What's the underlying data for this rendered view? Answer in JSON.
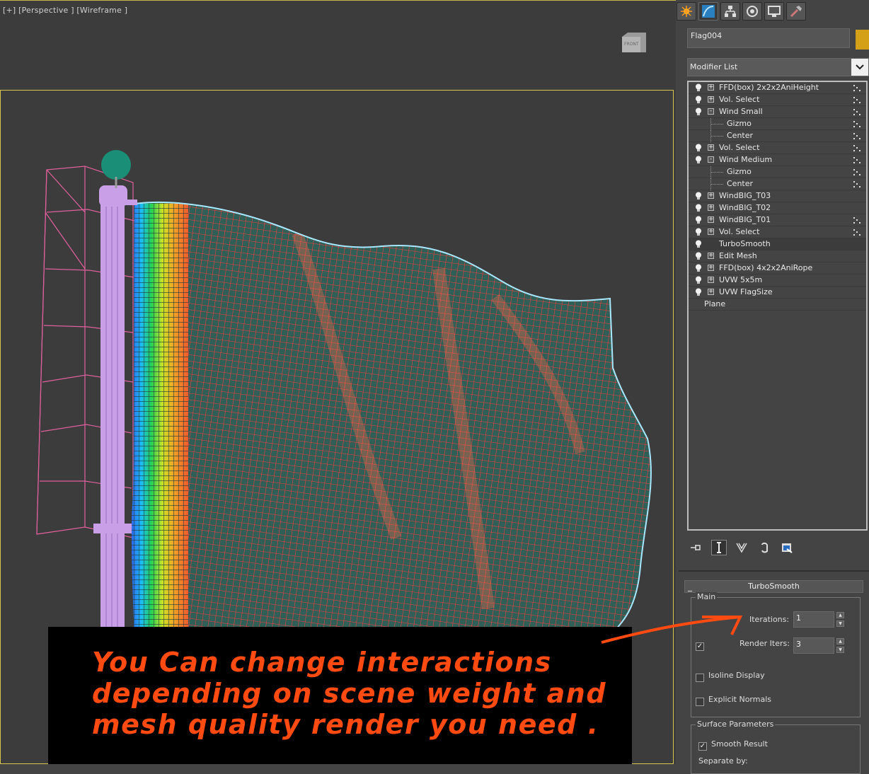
{
  "viewport": {
    "label_plus": "[+]",
    "label_view": "[Perspective ]",
    "label_shading": "[Wireframe ]",
    "viewcube_label": "FRONT"
  },
  "caption": {
    "line1": "You Can  change interactions",
    "line2": "depending on scene weight and",
    "line3": "mesh quality render you need ."
  },
  "panel": {
    "tabs": [
      "create-icon",
      "modify-icon",
      "hierarchy-icon",
      "motion-icon",
      "display-icon",
      "utilities-icon"
    ],
    "object_name": "Flag004",
    "object_color": "#d4a017",
    "modifier_list_label": "Modifier List",
    "stack": [
      {
        "label": "FFD(box) 2x2x2AniHeight",
        "expand": "+",
        "bulb": true,
        "dots": true
      },
      {
        "label": "Vol. Select",
        "expand": "+",
        "bulb": true,
        "dots": true
      },
      {
        "label": "Wind Small",
        "expand": "-",
        "bulb": true,
        "dots": true
      },
      {
        "label": "Gizmo",
        "sub": true,
        "dots": true
      },
      {
        "label": "Center",
        "sub": true,
        "dots": true
      },
      {
        "label": "Vol. Select",
        "expand": "+",
        "bulb": true,
        "dots": true
      },
      {
        "label": "Wind Medium",
        "expand": "-",
        "bulb": true,
        "dots": true
      },
      {
        "label": "Gizmo",
        "sub": true,
        "dots": true
      },
      {
        "label": "Center",
        "sub": true,
        "dots": true
      },
      {
        "label": "WindBIG_T03",
        "expand": "+",
        "bulb": true,
        "dots": false
      },
      {
        "label": "WindBIG_T02",
        "expand": "+",
        "bulb": true,
        "dots": false
      },
      {
        "label": "WindBIG_T01",
        "expand": "+",
        "bulb": true,
        "dots": true
      },
      {
        "label": "Vol. Select",
        "expand": "+",
        "bulb": true,
        "dots": true
      },
      {
        "label": "TurboSmooth",
        "bulb": true,
        "selected": true,
        "dots": false
      },
      {
        "label": "Edit Mesh",
        "expand": "+",
        "bulb": true,
        "dots": false
      },
      {
        "label": "FFD(box) 4x2x2AniRope",
        "expand": "+",
        "bulb": true,
        "dots": false
      },
      {
        "label": "UVW 5x5m",
        "expand": "+",
        "bulb": true,
        "dots": false
      },
      {
        "label": "UVW FlagSize",
        "expand": "+",
        "bulb": true,
        "dots": false
      },
      {
        "label": "Plane",
        "base": true,
        "dots": false
      }
    ],
    "stack_tools": [
      "pin-stack-icon",
      "show-end-result-icon",
      "make-unique-icon",
      "remove-modifier-icon",
      "configure-modifier-sets-icon"
    ],
    "rollout": {
      "minus": "_",
      "title": "TurboSmooth",
      "main_group": "Main",
      "iterations_label": "Iterations:",
      "iterations_value": "1",
      "render_iters_label": "Render Iters:",
      "render_iters_value": "3",
      "render_iters_checked": "✓",
      "isoline_label": "Isoline Display",
      "explicit_normals_label": "Explicit Normals",
      "surface_group": "Surface Parameters",
      "smooth_result_label": "Smooth Result",
      "smooth_result_checked": "✓",
      "separate_by_label": "Separate by:"
    }
  }
}
